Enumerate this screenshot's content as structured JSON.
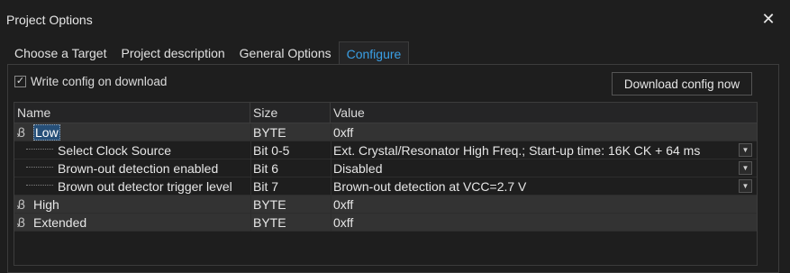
{
  "window": {
    "title": "Project Options",
    "close_glyph": "✕"
  },
  "tabs": [
    {
      "label": "Choose a Target",
      "active": false
    },
    {
      "label": "Project description",
      "active": false
    },
    {
      "label": "General Options",
      "active": false
    },
    {
      "label": "Configure",
      "active": true
    }
  ],
  "configure": {
    "write_config": {
      "label": "Write config on download",
      "checked": true
    },
    "download_button": "Download config now",
    "columns": {
      "name": "Name",
      "size": "Size",
      "value": "Value"
    },
    "rows": [
      {
        "kind": "group",
        "icon": "register-icon",
        "name": "Low",
        "size": "BYTE",
        "value": "0xff",
        "selected": true
      },
      {
        "kind": "child",
        "name": "Select Clock Source",
        "size": "Bit 0-5",
        "value": "Ext. Crystal/Resonator High Freq.; Start-up time: 16K CK + 64 ms"
      },
      {
        "kind": "child",
        "name": "Brown-out detection enabled",
        "size": "Bit 6",
        "value": "Disabled"
      },
      {
        "kind": "child",
        "name": "Brown out detector trigger level",
        "size": "Bit 7",
        "value": "Brown-out detection at VCC=2.7 V"
      },
      {
        "kind": "group",
        "icon": "register-icon",
        "name": "High",
        "size": "BYTE",
        "value": "0xff"
      },
      {
        "kind": "group",
        "icon": "register-icon",
        "name": "Extended",
        "size": "BYTE",
        "value": "0xff"
      }
    ]
  },
  "icons": {
    "tree_glyph": "Ᏸ",
    "dropdown_glyph": "▼",
    "check_glyph": "✓"
  },
  "colors": {
    "accent": "#3aa0e6",
    "background": "#1e1e1e",
    "group_row": "#333333",
    "selection": "#264f78"
  }
}
